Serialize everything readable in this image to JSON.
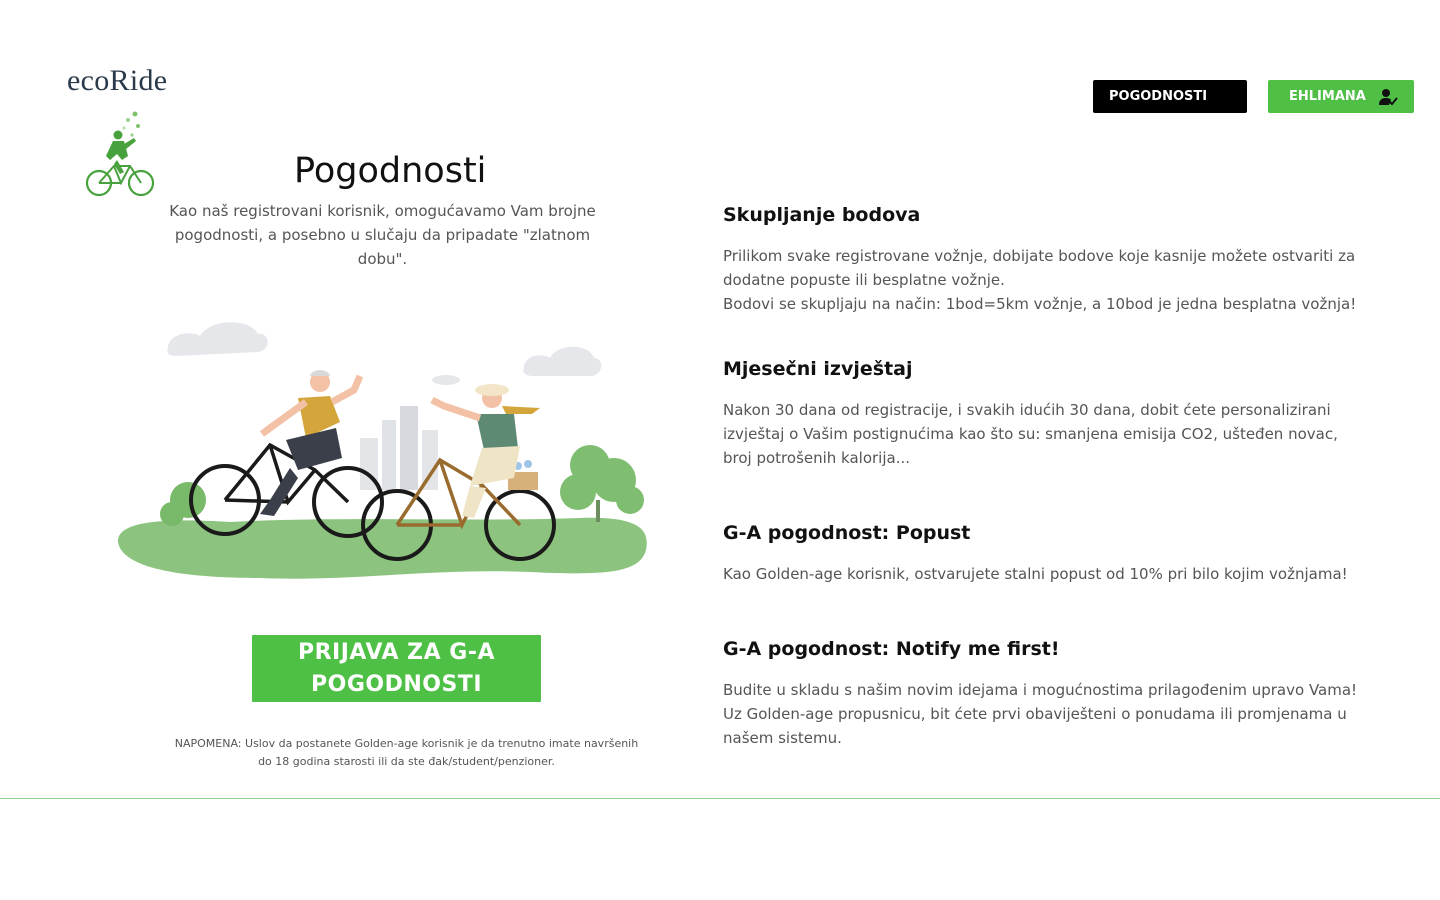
{
  "brand": {
    "name": "ecoRide",
    "icon": "cyclist-logo-icon"
  },
  "nav": {
    "benefits_label": "POGODNOSTI",
    "user_label": "EHLIMANA",
    "user_icon": "user-check-icon",
    "accent_color": "#4fbf46"
  },
  "hero": {
    "title": "Pogodnosti",
    "intro": "Kao naš registrovani korisnik, omogućavamo Vam brojne pogodnosti, a posebno u slučaju da pripadate \"zlatnom dobu\".",
    "illustration": "elderly-couple-cycling-illustration"
  },
  "cta": {
    "label": "PRIJAVA ZA G-A POGODNOSTI"
  },
  "note": "NAPOMENA: Uslov da postanete Golden-age korisnik je da trenutno imate navršenih do 18 godina starosti ili da ste đak/student/penzioner.",
  "benefits": [
    {
      "title": "Skupljanje bodova",
      "text_1": "Prilikom svake registrovane vožnje, dobijate bodove koje kasnije možete ostvariti za dodatne popuste ili besplatne vožnje.",
      "text_2": "Bodovi se skupljaju na način: 1bod=5km vožnje, a 10bod je jedna besplatna vožnja!"
    },
    {
      "title": "Mjesečni izvještaj",
      "text_1": "Nakon 30 dana od registracije, i svakih idućih 30 dana, dobit ćete personalizirani izvještaj o Vašim postignućima  kao što su: smanjena emisija CO2, ušteđen novac, broj potrošenih kalorija..."
    },
    {
      "title": "G-A pogodnost: Popust",
      "text_1": "Kao Golden-age korisnik, ostvarujete stalni popust od 10% pri bilo kojim vožnjama!"
    },
    {
      "title": "G-A pogodnost: Notify me first!",
      "text_1": "Budite u skladu s našim novim idejama i mogućnostima prilagođenim upravo Vama! Uz Golden-age propusnicu, bit ćete prvi obaviješteni o ponudama ili promjenama u našem sistemu."
    }
  ]
}
